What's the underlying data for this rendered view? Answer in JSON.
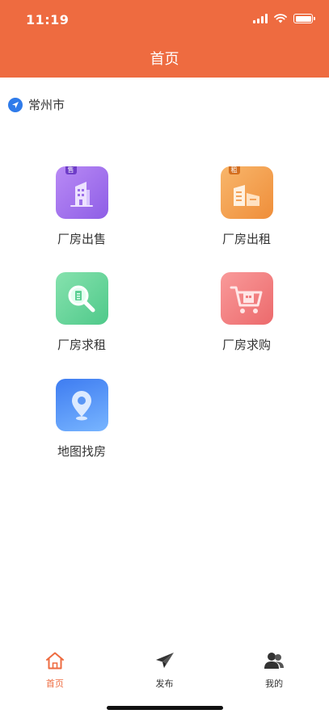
{
  "status_bar": {
    "time": "11:19"
  },
  "header": {
    "title": "首页"
  },
  "location": {
    "city": "常州市"
  },
  "menu": [
    {
      "label": "厂房出售",
      "badge": "售"
    },
    {
      "label": "厂房出租",
      "badge": "租"
    },
    {
      "label": "厂房求租"
    },
    {
      "label": "厂房求购"
    },
    {
      "label": "地图找房"
    }
  ],
  "tabbar": [
    {
      "label": "首页",
      "icon": "home-icon",
      "active": true
    },
    {
      "label": "发布",
      "icon": "paper-plane-icon",
      "active": false
    },
    {
      "label": "我的",
      "icon": "user-icon",
      "active": false
    }
  ],
  "colors": {
    "primary": "#EE6B40",
    "location_icon": "#2F7BEA"
  }
}
